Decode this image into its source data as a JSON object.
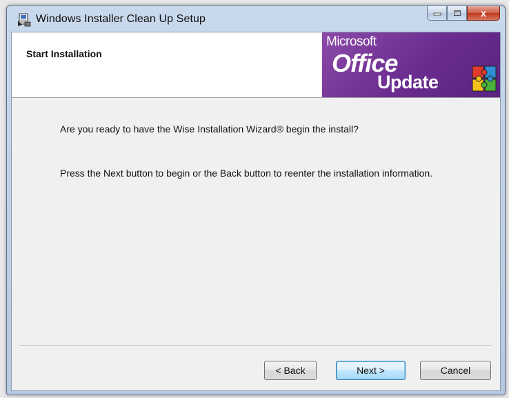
{
  "window": {
    "title": "Windows Installer Clean Up Setup",
    "close_glyph": "x"
  },
  "banner": {
    "title": "Start Installation",
    "logo": {
      "microsoft": "Microsoft",
      "office": "Office",
      "update": "Update"
    }
  },
  "body": {
    "line1": "Are you ready to have the Wise Installation Wizard® begin the install?",
    "line2": "Press the Next button to begin or the Back button to reenter the installation information."
  },
  "buttons": {
    "back": "< Back",
    "next": "Next >",
    "cancel": "Cancel"
  },
  "colors": {
    "logo_purple": "#6a2c8f",
    "close_red": "#c0391f",
    "default_button_border": "#3c7fb1"
  }
}
